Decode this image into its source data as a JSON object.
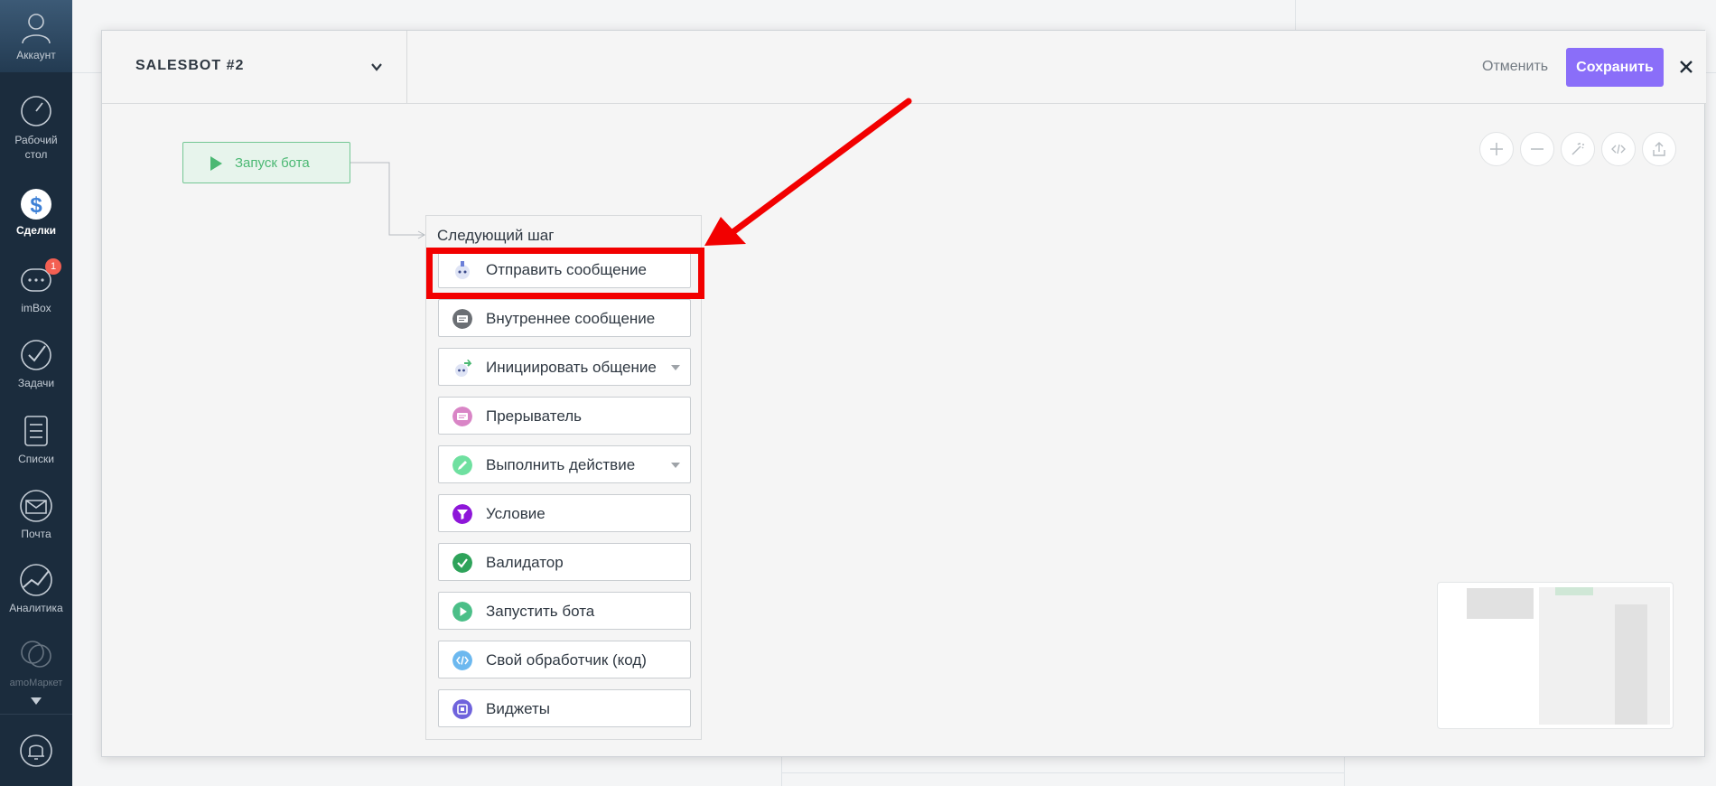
{
  "nav": {
    "account": "Аккаунт",
    "dashboard": "Рабочий стол",
    "deals": "Сделки",
    "imbox": "imBox",
    "imbox_badge": "1",
    "tasks": "Задачи",
    "lists": "Списки",
    "mail": "Почта",
    "analytics": "Аналитика",
    "market": "amoМаркет"
  },
  "header": {
    "bot_name": "SALESBOT #2",
    "cancel_label": "Отменить",
    "save_label": "Сохранить"
  },
  "canvas": {
    "start_node_label": "Запуск бота",
    "panel_title": "Следующий шаг",
    "steps": [
      {
        "label": "Отправить сообщение",
        "icon": "robot-send-icon",
        "has_dropdown": false
      },
      {
        "label": "Внутреннее сообщение",
        "icon": "internal-message-icon",
        "has_dropdown": false
      },
      {
        "label": "Инициировать общение",
        "icon": "robot-initiate-icon",
        "has_dropdown": true
      },
      {
        "label": "Прерыватель",
        "icon": "interrupter-icon",
        "has_dropdown": false
      },
      {
        "label": "Выполнить действие",
        "icon": "action-pencil-icon",
        "has_dropdown": true
      },
      {
        "label": "Условие",
        "icon": "condition-filter-icon",
        "has_dropdown": false
      },
      {
        "label": "Валидатор",
        "icon": "validator-check-icon",
        "has_dropdown": false
      },
      {
        "label": "Запустить бота",
        "icon": "run-bot-play-icon",
        "has_dropdown": false
      },
      {
        "label": "Свой обработчик (код)",
        "icon": "code-handler-icon",
        "has_dropdown": false
      },
      {
        "label": "Виджеты",
        "icon": "widgets-icon",
        "has_dropdown": false
      }
    ]
  },
  "colors": {
    "sidebar": "#1b2c3d",
    "save_button": "#8a6ef9",
    "start_green": "#4bb873",
    "highlight_red": "#f20000"
  }
}
